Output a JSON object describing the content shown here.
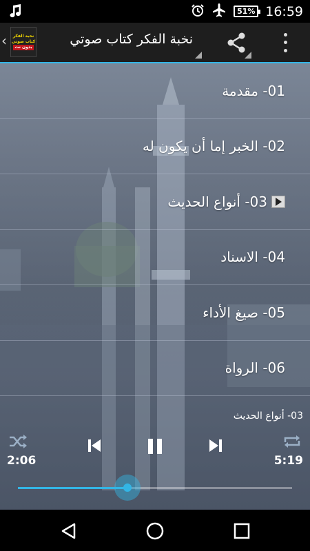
{
  "status_bar": {
    "time": "16:59",
    "battery_level": "51%",
    "icons": [
      "music-note-icon",
      "alarm-icon",
      "airplane-mode-icon",
      "battery-icon"
    ]
  },
  "action_bar": {
    "title": "نخبة الفكر كتاب صوتي",
    "logo": {
      "line1": "نخبة الفكر",
      "line2": "كتاب صوتي",
      "line3": "بدون نت"
    },
    "accent_color": "#33b5e5"
  },
  "tracks": [
    {
      "label": "01- مقدمة",
      "playing": false
    },
    {
      "label": "02- الخبر إما أن يكون له",
      "playing": false
    },
    {
      "label": "03- أنواع الحديث",
      "playing": true
    },
    {
      "label": "04- الاسناد",
      "playing": false
    },
    {
      "label": "05- صيغ الأداء",
      "playing": false
    },
    {
      "label": "06- الرواة",
      "playing": false
    }
  ],
  "player": {
    "now_playing": "03- أنواع الحديث",
    "elapsed": "2:06",
    "total": "5:19",
    "progress_fraction": 0.4
  }
}
